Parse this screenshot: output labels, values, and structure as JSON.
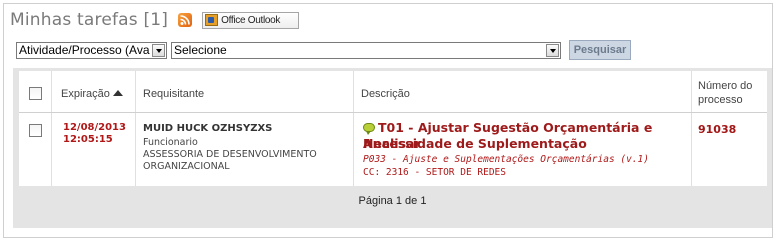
{
  "header": {
    "title": "Minhas tarefas [1]",
    "rss_icon": "rss-icon",
    "outlook_label": "Office Outlook"
  },
  "filters": {
    "activity_select_value": "Atividade/Processo (Ava",
    "second_select_value": "Selecione",
    "search_button": "Pesquisar"
  },
  "table": {
    "columns": {
      "expiration": "Expiração",
      "requester": "Requisitante",
      "description": "Descrição",
      "process_number_line1": "Número do",
      "process_number_line2": "processo"
    },
    "rows": [
      {
        "date": "12/08/2013",
        "time": "12:05:15",
        "requester_name": "MUID HUCK OZHSYZXS",
        "requester_role": "Funcionario",
        "requester_dept_line1": "ASSESSORIA DE DESENVOLVIMENTO",
        "requester_dept_line2": "ORGANIZACIONAL",
        "task_title_line1": "T01 - Ajustar Sugestão Orçamentária e Analisar",
        "task_title_line2": "Necessidade de Suplementação",
        "task_subtitle": "P033 - Ajuste e Suplementações Orçamentárias (v.1)",
        "task_cc": "CC: 2316 - SETOR DE REDES",
        "process_number": "91038"
      }
    ]
  },
  "pager": {
    "text": "Página 1 de 1"
  },
  "colors": {
    "accent_red": "#b01818",
    "button_bg": "#cdd7e4"
  }
}
